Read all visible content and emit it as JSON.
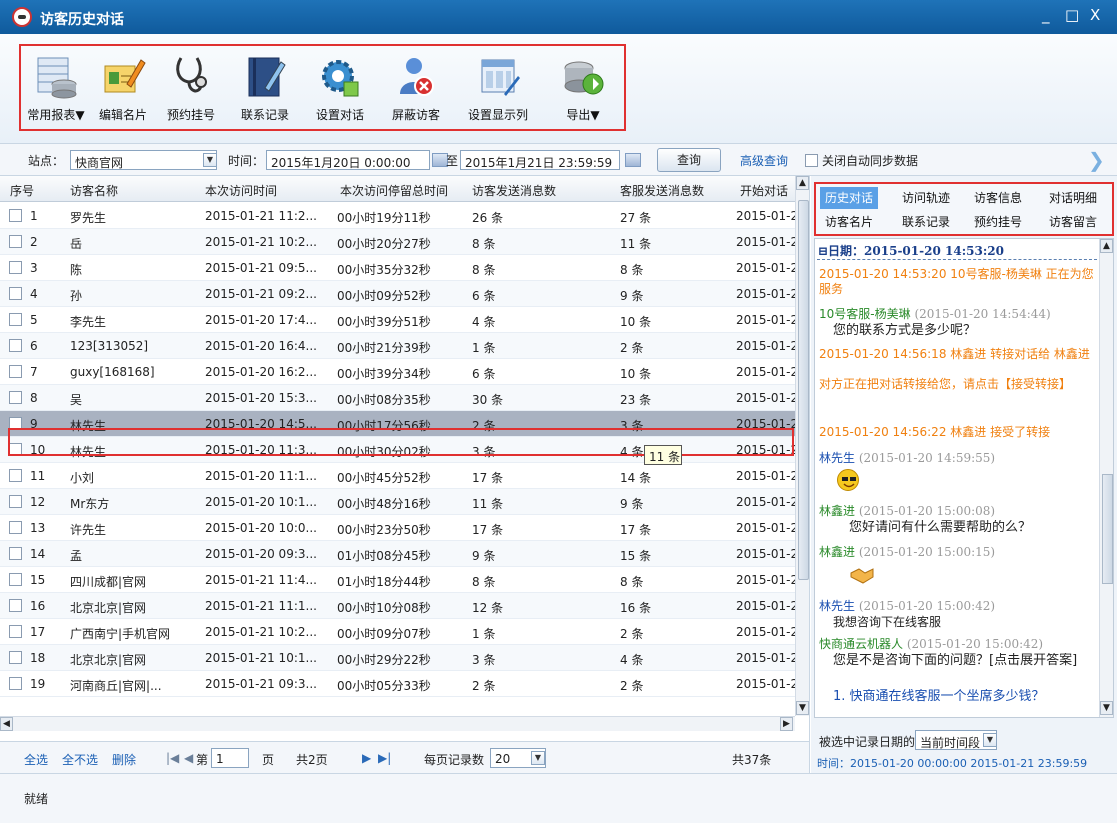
{
  "window": {
    "title": "访客历史对话",
    "minimize": "_",
    "maximize": "□",
    "close": "X"
  },
  "toolbar": [
    {
      "label": "常用报表▼",
      "icon": "database-report-icon"
    },
    {
      "label": "编辑名片",
      "icon": "edit-card-icon"
    },
    {
      "label": "预约挂号",
      "icon": "stethoscope-icon"
    },
    {
      "label": "联系记录",
      "icon": "notebook-icon"
    },
    {
      "label": "设置对话",
      "icon": "gear-settings-icon"
    },
    {
      "label": "屏蔽访客",
      "icon": "block-visitor-icon"
    },
    {
      "label": "设置显示列",
      "icon": "columns-settings-icon"
    },
    {
      "label": "导出▼",
      "icon": "export-icon"
    }
  ],
  "filter": {
    "site_label": "站点：",
    "site_value": "快商官网",
    "time_label": "时间：",
    "time_from": "2015年1月20日 0:00:00",
    "to_label": "至",
    "time_to": "2015年1月21日 23:59:59",
    "query_button": "查询",
    "advanced_query": "高级查询",
    "auto_sync_label": "关闭自动同步数据",
    "next_icon": "chevron-right-icon"
  },
  "table": {
    "columns": [
      "序号",
      "访客名称",
      "本次访问时间",
      "本次访问停留总时间",
      "访客发送消息数",
      "客服发送消息数",
      "开始对话"
    ],
    "rows": [
      {
        "no": "1",
        "name": "罗先生",
        "visit": "2015-01-21 11:2...",
        "stay": "00小时19分11秒",
        "vmsg": "26 条",
        "smsg": "27 条",
        "start": "2015-01-2"
      },
      {
        "no": "2",
        "name": "岳",
        "visit": "2015-01-21 10:2...",
        "stay": "00小时20分27秒",
        "vmsg": "8 条",
        "smsg": "11 条",
        "start": "2015-01-2"
      },
      {
        "no": "3",
        "name": "陈",
        "visit": "2015-01-21 09:5...",
        "stay": "00小时35分32秒",
        "vmsg": "8 条",
        "smsg": "8 条",
        "start": "2015-01-2"
      },
      {
        "no": "4",
        "name": "孙",
        "visit": "2015-01-21 09:2...",
        "stay": "00小时09分52秒",
        "vmsg": "6 条",
        "smsg": "9 条",
        "start": "2015-01-2"
      },
      {
        "no": "5",
        "name": "李先生",
        "visit": "2015-01-20 17:4...",
        "stay": "00小时39分51秒",
        "vmsg": "4 条",
        "smsg": "10 条",
        "start": "2015-01-2"
      },
      {
        "no": "6",
        "name": "123[313052]",
        "visit": "2015-01-20 16:4...",
        "stay": "00小时21分39秒",
        "vmsg": "1 条",
        "smsg": "2 条",
        "start": "2015-01-2"
      },
      {
        "no": "7",
        "name": "guxy[168168]",
        "visit": "2015-01-20 16:2...",
        "stay": "00小时39分34秒",
        "vmsg": "6 条",
        "smsg": "10 条",
        "start": "2015-01-2"
      },
      {
        "no": "8",
        "name": "吴",
        "visit": "2015-01-20 15:3...",
        "stay": "00小时08分35秒",
        "vmsg": "30 条",
        "smsg": "23 条",
        "start": "2015-01-2"
      },
      {
        "no": "9",
        "name": "林先生",
        "visit": "2015-01-20 14:5...",
        "stay": "00小时17分56秒",
        "vmsg": "2 条",
        "smsg": "3 条",
        "start": "2015-01-2"
      },
      {
        "no": "10",
        "name": "林先生",
        "visit": "2015-01-20 11:3...",
        "stay": "00小时30分02秒",
        "vmsg": "3 条",
        "smsg": "4 条",
        "start": "2015-01-2"
      },
      {
        "no": "11",
        "name": "小刘",
        "visit": "2015-01-20 11:1...",
        "stay": "00小时45分52秒",
        "vmsg": "17 条",
        "smsg": "14 条",
        "start": "2015-01-2"
      },
      {
        "no": "12",
        "name": "Mr东方",
        "visit": "2015-01-20 10:1...",
        "stay": "00小时48分16秒",
        "vmsg": "11 条",
        "smsg": "9 条",
        "start": "2015-01-2"
      },
      {
        "no": "13",
        "name": "许先生",
        "visit": "2015-01-20 10:0...",
        "stay": "00小时23分50秒",
        "vmsg": "17 条",
        "smsg": "17 条",
        "start": "2015-01-2"
      },
      {
        "no": "14",
        "name": "孟",
        "visit": "2015-01-20 09:3...",
        "stay": "01小时08分45秒",
        "vmsg": "9 条",
        "smsg": "15 条",
        "start": "2015-01-2"
      },
      {
        "no": "15",
        "name": "四川成都|官网",
        "visit": "2015-01-21 11:4...",
        "stay": "01小时18分44秒",
        "vmsg": "8 条",
        "smsg": "8 条",
        "start": "2015-01-2"
      },
      {
        "no": "16",
        "name": "北京北京|官网",
        "visit": "2015-01-21 11:1...",
        "stay": "00小时10分08秒",
        "vmsg": "12 条",
        "smsg": "16 条",
        "start": "2015-01-2"
      },
      {
        "no": "17",
        "name": "广西南宁|手机官网",
        "visit": "2015-01-21 10:2...",
        "stay": "00小时09分07秒",
        "vmsg": "1 条",
        "smsg": "2 条",
        "start": "2015-01-2"
      },
      {
        "no": "18",
        "name": "北京北京|官网",
        "visit": "2015-01-21 10:1...",
        "stay": "00小时29分22秒",
        "vmsg": "3 条",
        "smsg": "4 条",
        "start": "2015-01-2"
      },
      {
        "no": "19",
        "name": "河南商丘|官网|...",
        "visit": "2015-01-21 09:3...",
        "stay": "00小时05分33秒",
        "vmsg": "2 条",
        "smsg": "2 条",
        "start": "2015-01-2"
      }
    ],
    "tooltip": "11 条"
  },
  "pager": {
    "select_all": "全选",
    "select_none": "全不选",
    "delete": "删除",
    "page_prefix": "第",
    "page_value": "1",
    "page_suffix": "页",
    "total_pages": "共2页",
    "per_page_label": "每页记录数",
    "per_page_value": "20",
    "total_records": "共37条"
  },
  "right": {
    "tabs": [
      "历史对话",
      "访问轨迹",
      "访客信息",
      "对话明细",
      "访客名片",
      "联系记录",
      "预约挂号",
      "访客留言"
    ],
    "date_header": "⊟日期：2015-01-20 14:53:20",
    "msgs": {
      "m1": "2015-01-20 14:53:20 10号客服-杨美琳 正在为您服务",
      "m2_name": "10号客服-杨美琳",
      "m2_time": "(2015-01-20 14:54:44)",
      "m2_text": "您的联系方式是多少呢？",
      "m3": "2015-01-20 14:56:18 林鑫进 转接对话给 林鑫进",
      "m3b": "对方正在把对话转接给您，请点击【接受转接】",
      "m4": "2015-01-20 14:56:22 林鑫进 接受了转接",
      "m5_name": "林先生",
      "m5_time": "(2015-01-20 14:59:55)",
      "m6_name": "林鑫进",
      "m6_time": "(2015-01-20 15:00:08)",
      "m6_text": "您好请问有什么需要帮助的么？",
      "m7_name": "林鑫进",
      "m7_time": "(2015-01-20 15:00:15)",
      "m8_name": "林先生",
      "m8_time": "(2015-01-20 15:00:42)",
      "m8_text": "我想咨询下在线客服",
      "m9_name": "快商通云机器人",
      "m9_time": "(2015-01-20 15:00:42)",
      "m9_text": "您是不是咨询下面的问题？[点击展开答案]",
      "m9_item": "1.  快商通在线客服一个坐席多少钱？"
    },
    "footer_label": "被选中记录日期的：",
    "footer_value": "当前时间段",
    "footer_time": "时间：2015-01-20 00:00:00 2015-01-21 23:59:59"
  },
  "status": "就绪",
  "colors": {
    "titlebar": "#1a68ad",
    "highlight": "#e03030",
    "selected_row": "#a9b2c1",
    "active_tab": "#5aa0e6",
    "link": "#1a5fb4",
    "orange": "#f08010",
    "green": "#2a8a2a"
  }
}
